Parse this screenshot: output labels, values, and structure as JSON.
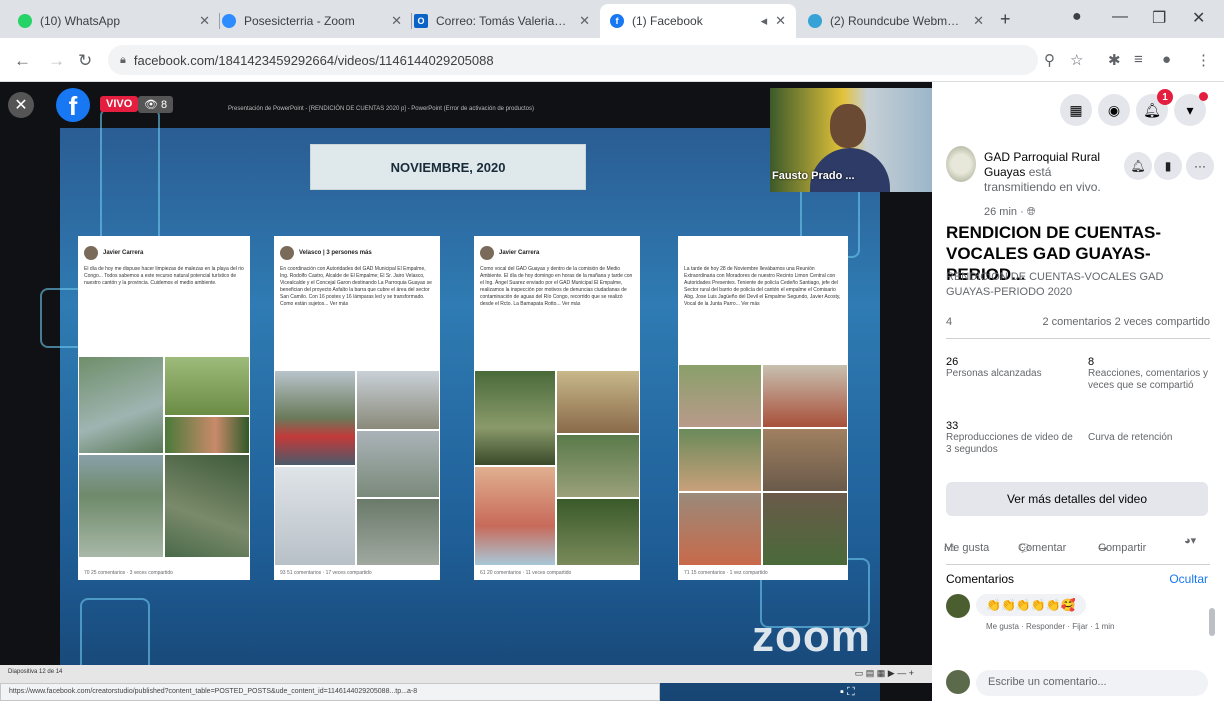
{
  "browser": {
    "tabs": [
      {
        "label": "(10) WhatsApp",
        "color": "#25d366",
        "active": false
      },
      {
        "label": "Posesicterria - Zoom",
        "color": "#2d8cff",
        "active": false
      },
      {
        "label": "Correo: Tomás Valeriano - Ca",
        "color": "#0a64c8",
        "active": false
      },
      {
        "label": "(1) Facebook",
        "color": "#1877f2",
        "active": true
      },
      {
        "label": "(2) Roundcube Webmail :: E",
        "color": "#37a2d6",
        "active": false
      }
    ],
    "url": "facebook.com/1841423459292664/videos/1146144029205088",
    "new_tab": "+"
  },
  "video": {
    "live_label": "VIVO",
    "viewer_count": "8",
    "ppt_title": "Presentación de PowerPoint - [RENDICIÓN DE CUENTAS 2020 p] - PowerPoint (Error de activación de productos)",
    "slide_heading": "NOVIEMBRE, 2020",
    "speaker_name": "Fausto Prado ...",
    "zoom_watermark": "zoom",
    "status_text": "Diapositiva 12 de 14",
    "hover_url": "https://www.facebook.com/creatorstudio/published?content_table=POSTED_POSTS&ude_content_id=1146144029205088...tp...a-8",
    "posts": [
      {
        "name": "Javier Carrera",
        "text": "El día de hoy me dispuse hacer limpiezas de malezas en la playa del rio Congo... Todos sabemos a este recurso natural potencial turístico de nuestro cantón y la provincia. Cuidemos el medio ambiente.",
        "footer": "70   25 comentarios · 3 veces compartido"
      },
      {
        "name": "Velasco | 3 persones más",
        "text": "En coordinación con Autoridades del GAD Municipal El Empalme, Ing. Rodolfo Castro, Alcalde de El Empalme; El Sr. Jairo Velasco, Vicealcalde y el Concejal Garon destinando La Parroquia Guayas se benefician del proyecto Asfalto la barra que cubre el área del sector San Camilo. Con 16 postes y 16 lámparas led y se transformado. Como están sujetos... Ver más",
        "footer": "93   51 comentarios · 17 veces compartido"
      },
      {
        "name": "Javier Carrera",
        "text": "Como vocal del GAD Guayas y dentro de la comisión de Medio Ambiente. El día de hoy domingo en horas de la mañana y tarde con el Ing. Ángel Suarez enviado por el GAD Municipal El Empalme, realizamos la inspección por motivos de denuncias ciudadanas de contaminación de aguas del Río Congo, recorrido que se realizó desde el Rcto. La Bamapata Rotto... Ver más",
        "footer": "61   20 comentarios · 11 veces compartido"
      },
      {
        "name": "",
        "text": "La tarde de hoy 28 de Noviembre llevábamos una Reunión Extraordinaria con Moradores de nuestro Recinto Limon Central con Autoridades Presentes. Teniente de policía Cedeño Santiago, jefe del Sector rural del barrio de policía del cantón el empalme el Comisario Abg. Jose Luis Jagüeño del Devil el Empalme Segundo, Javier Acosty, Vocal de la Junta Parro... Ver más",
        "footer": "71   15 comentarios · 1 vez compartido"
      }
    ]
  },
  "panel": {
    "page_name": "GAD Parroquial Rural Guayas",
    "page_status": "está transmitiendo en vivo.",
    "time": "26 min · ",
    "video_title": "RENDICION DE CUENTAS-VOCALES GAD GUAYAS-PERIOD...",
    "description": "RENDICION DE CUENTAS-VOCALES GAD GUAYAS-PERIODO 2020",
    "reactions": "4",
    "stats_text": "2 comentarios  2 veces compartido",
    "metrics": [
      {
        "value": "26",
        "label": "Personas alcanzadas"
      },
      {
        "value": "8",
        "label": "Reacciones, comentarios y veces que se compartió"
      },
      {
        "value": "33",
        "label": "Reproducciones de video de 3 segundos"
      },
      {
        "value": "",
        "label": "Curva de retención"
      }
    ],
    "more_details": "Ver más detalles del video",
    "like": "Me gusta",
    "comment": "Comentar",
    "share": "Compartir",
    "comments_header": "Comentarios",
    "hide_label": "Ocultar",
    "comment_text": "👏👏👏👏👏🥰",
    "comment_meta": "Me gusta · Responder · Fijar · 1 min",
    "write_placeholder": "Escribe un comentario...",
    "notif_count": "1"
  }
}
